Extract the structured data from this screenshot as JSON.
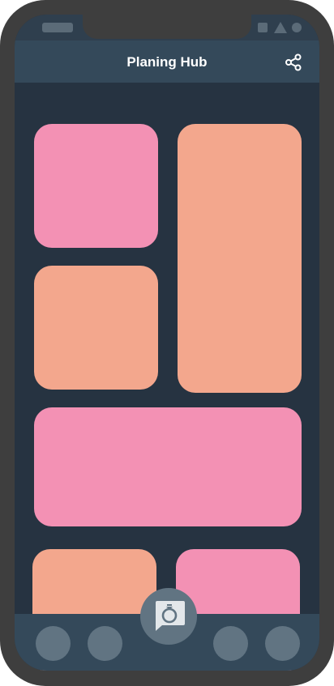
{
  "header": {
    "title": "Planing Hub",
    "share_icon": "share-icon"
  },
  "colors": {
    "background": "#263341",
    "app_bar": "#34495a",
    "frame": "#3e3e3e",
    "tile_pink": "#f391b4",
    "tile_salmon": "#f3a78d",
    "nav_button": "#617482"
  },
  "grid": {
    "tiles": [
      {
        "name": "tile-1",
        "color": "pink"
      },
      {
        "name": "tile-2",
        "color": "salmon"
      },
      {
        "name": "tile-3",
        "color": "salmon"
      },
      {
        "name": "tile-4",
        "color": "pink"
      },
      {
        "name": "tile-5",
        "color": "salmon"
      },
      {
        "name": "tile-6",
        "color": "pink"
      }
    ]
  },
  "bottom_nav": {
    "items": [
      {
        "name": "nav-item-1"
      },
      {
        "name": "nav-item-2"
      },
      {
        "name": "nav-item-3"
      },
      {
        "name": "nav-item-4"
      }
    ],
    "fab_icon": "ring-chat-icon"
  }
}
